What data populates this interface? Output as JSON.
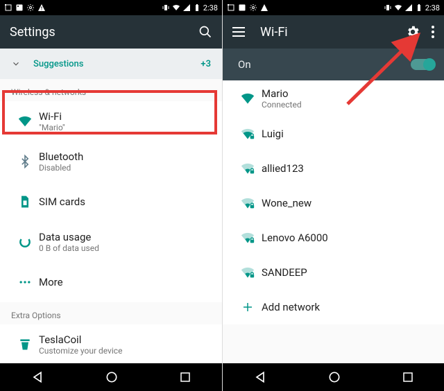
{
  "status": {
    "time": "2:38"
  },
  "left": {
    "title": "Settings",
    "suggestions": {
      "label": "Suggestions",
      "count": "+3"
    },
    "section_wireless": "Wireless & networks",
    "items": [
      {
        "label": "Wi-Fi",
        "sub": "\"Mario\""
      },
      {
        "label": "Bluetooth",
        "sub": "Disabled"
      },
      {
        "label": "SIM cards",
        "sub": ""
      },
      {
        "label": "Data usage",
        "sub": "0 B of data used"
      },
      {
        "label": "More",
        "sub": ""
      }
    ],
    "section_extra": "Extra Options",
    "extra": {
      "label": "TeslaCoil",
      "sub": "Customize your device"
    }
  },
  "right": {
    "title": "Wi-Fi",
    "state": "On",
    "networks": [
      {
        "name": "Mario",
        "sub": "Connected",
        "strength": 4,
        "secure": false
      },
      {
        "name": "Luigi",
        "sub": "",
        "strength": 3,
        "secure": true
      },
      {
        "name": "allied123",
        "sub": "",
        "strength": 2,
        "secure": true
      },
      {
        "name": "Wone_new",
        "sub": "",
        "strength": 2,
        "secure": true
      },
      {
        "name": "Lenovo A6000",
        "sub": "",
        "strength": 2,
        "secure": true
      },
      {
        "name": "SANDEEP",
        "sub": "",
        "strength": 2,
        "secure": true
      }
    ],
    "add": "Add network"
  },
  "colors": {
    "teal": "#009688",
    "bar": "#263238",
    "subbar": "#37474f"
  }
}
